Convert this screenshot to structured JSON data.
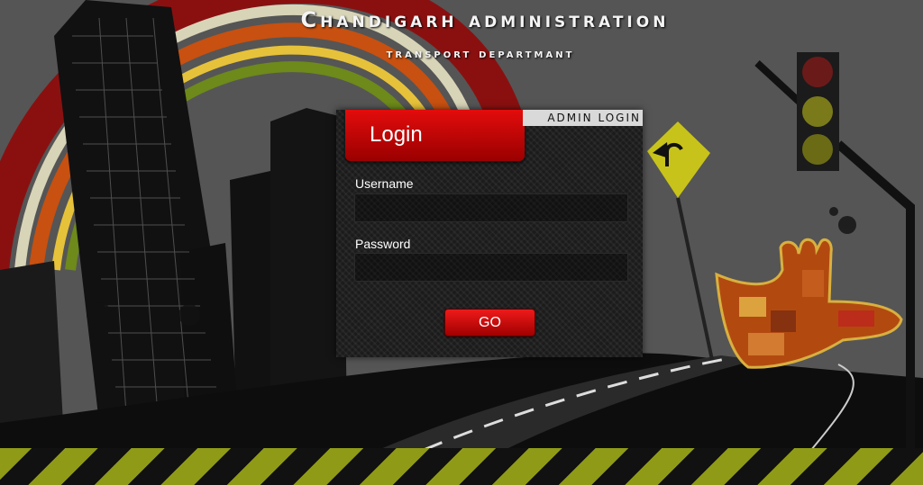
{
  "header": {
    "title": "Chandigarh administration",
    "subtitle": "transport departmant"
  },
  "login": {
    "tab_label": "Login",
    "admin_label": "ADMIN LOGIN",
    "username_label": "Username",
    "username_value": "",
    "password_label": "Password",
    "password_value": "",
    "submit_label": "GO"
  },
  "colors": {
    "accent_red": "#d40000",
    "background": "#555555",
    "stripe_yellow": "#8f9a17"
  },
  "icons": [
    "city-skyline",
    "traffic-light-icon",
    "turn-sign-icon",
    "hand-collage-icon",
    "rainbow-arc"
  ]
}
